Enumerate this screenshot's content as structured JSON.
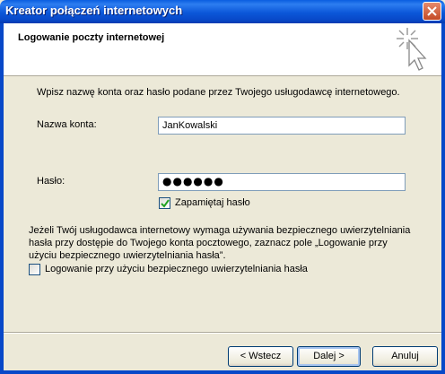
{
  "window": {
    "title": "Kreator połączeń internetowych"
  },
  "header": {
    "title": "Logowanie poczty internetowej",
    "icon": "wizard-cursor-icon"
  },
  "content": {
    "instruction": "Wpisz nazwę konta oraz hasło podane przez Twojego usługodawcę internetowego.",
    "account_label": "Nazwa konta:",
    "account_value": "JanKowalski",
    "password_label": "Hasło:",
    "password_value": "●●●●●●",
    "remember_label": "Zapamiętaj hasło",
    "remember_checked": true,
    "spa_info_line1": "Jeżeli Twój usługodawca internetowy wymaga używania bezpiecznego uwierzytelniania",
    "spa_info_line2": "hasła przy dostępie do Twojego konta pocztowego, zaznacz pole „Logowanie przy",
    "spa_info_line3": "użyciu bezpiecznego uwierzytelniania hasła”.",
    "spa_label": "Logowanie przy użyciu bezpiecznego uwierzytelniania hasła",
    "spa_checked": false
  },
  "buttons": {
    "back": "< Wstecz",
    "next": "Dalej >",
    "cancel": "Anuluj"
  },
  "colors": {
    "titlebar": "#0b57d9",
    "dialog_bg": "#ece9d8",
    "close_button": "#c44a25"
  }
}
